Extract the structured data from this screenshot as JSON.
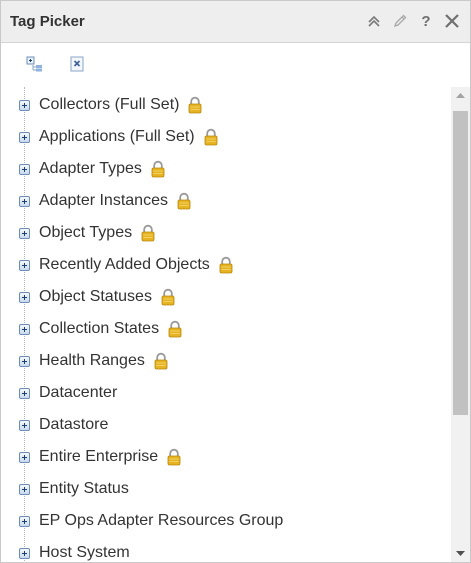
{
  "panel": {
    "title": "Tag Picker",
    "title_buttons": [
      {
        "name": "collapse-icon",
        "glyph": "»"
      },
      {
        "name": "edit-icon",
        "glyph": "pencil"
      },
      {
        "name": "help-icon",
        "glyph": "?"
      },
      {
        "name": "close-icon",
        "glyph": "×"
      }
    ]
  },
  "toolbar": {
    "buttons": [
      {
        "name": "expand-all-icon"
      },
      {
        "name": "deselect-all-icon"
      }
    ]
  },
  "tree": {
    "items": [
      {
        "label": "Collectors (Full Set)",
        "locked": true
      },
      {
        "label": "Applications (Full Set)",
        "locked": true
      },
      {
        "label": "Adapter Types",
        "locked": true
      },
      {
        "label": "Adapter Instances",
        "locked": true
      },
      {
        "label": "Object Types",
        "locked": true
      },
      {
        "label": "Recently Added Objects",
        "locked": true
      },
      {
        "label": "Object Statuses",
        "locked": true
      },
      {
        "label": "Collection States",
        "locked": true
      },
      {
        "label": "Health Ranges",
        "locked": true
      },
      {
        "label": "Datacenter",
        "locked": false
      },
      {
        "label": "Datastore",
        "locked": false
      },
      {
        "label": "Entire Enterprise",
        "locked": true
      },
      {
        "label": "Entity Status",
        "locked": false
      },
      {
        "label": "EP Ops Adapter Resources Group",
        "locked": false
      },
      {
        "label": "Host System",
        "locked": false
      }
    ]
  },
  "colors": {
    "titlebar_bg": "#eeeeee",
    "lock_gold": "#e6b422",
    "expander_border": "#6d8db8",
    "scroll_thumb": "#c1c1c1"
  }
}
